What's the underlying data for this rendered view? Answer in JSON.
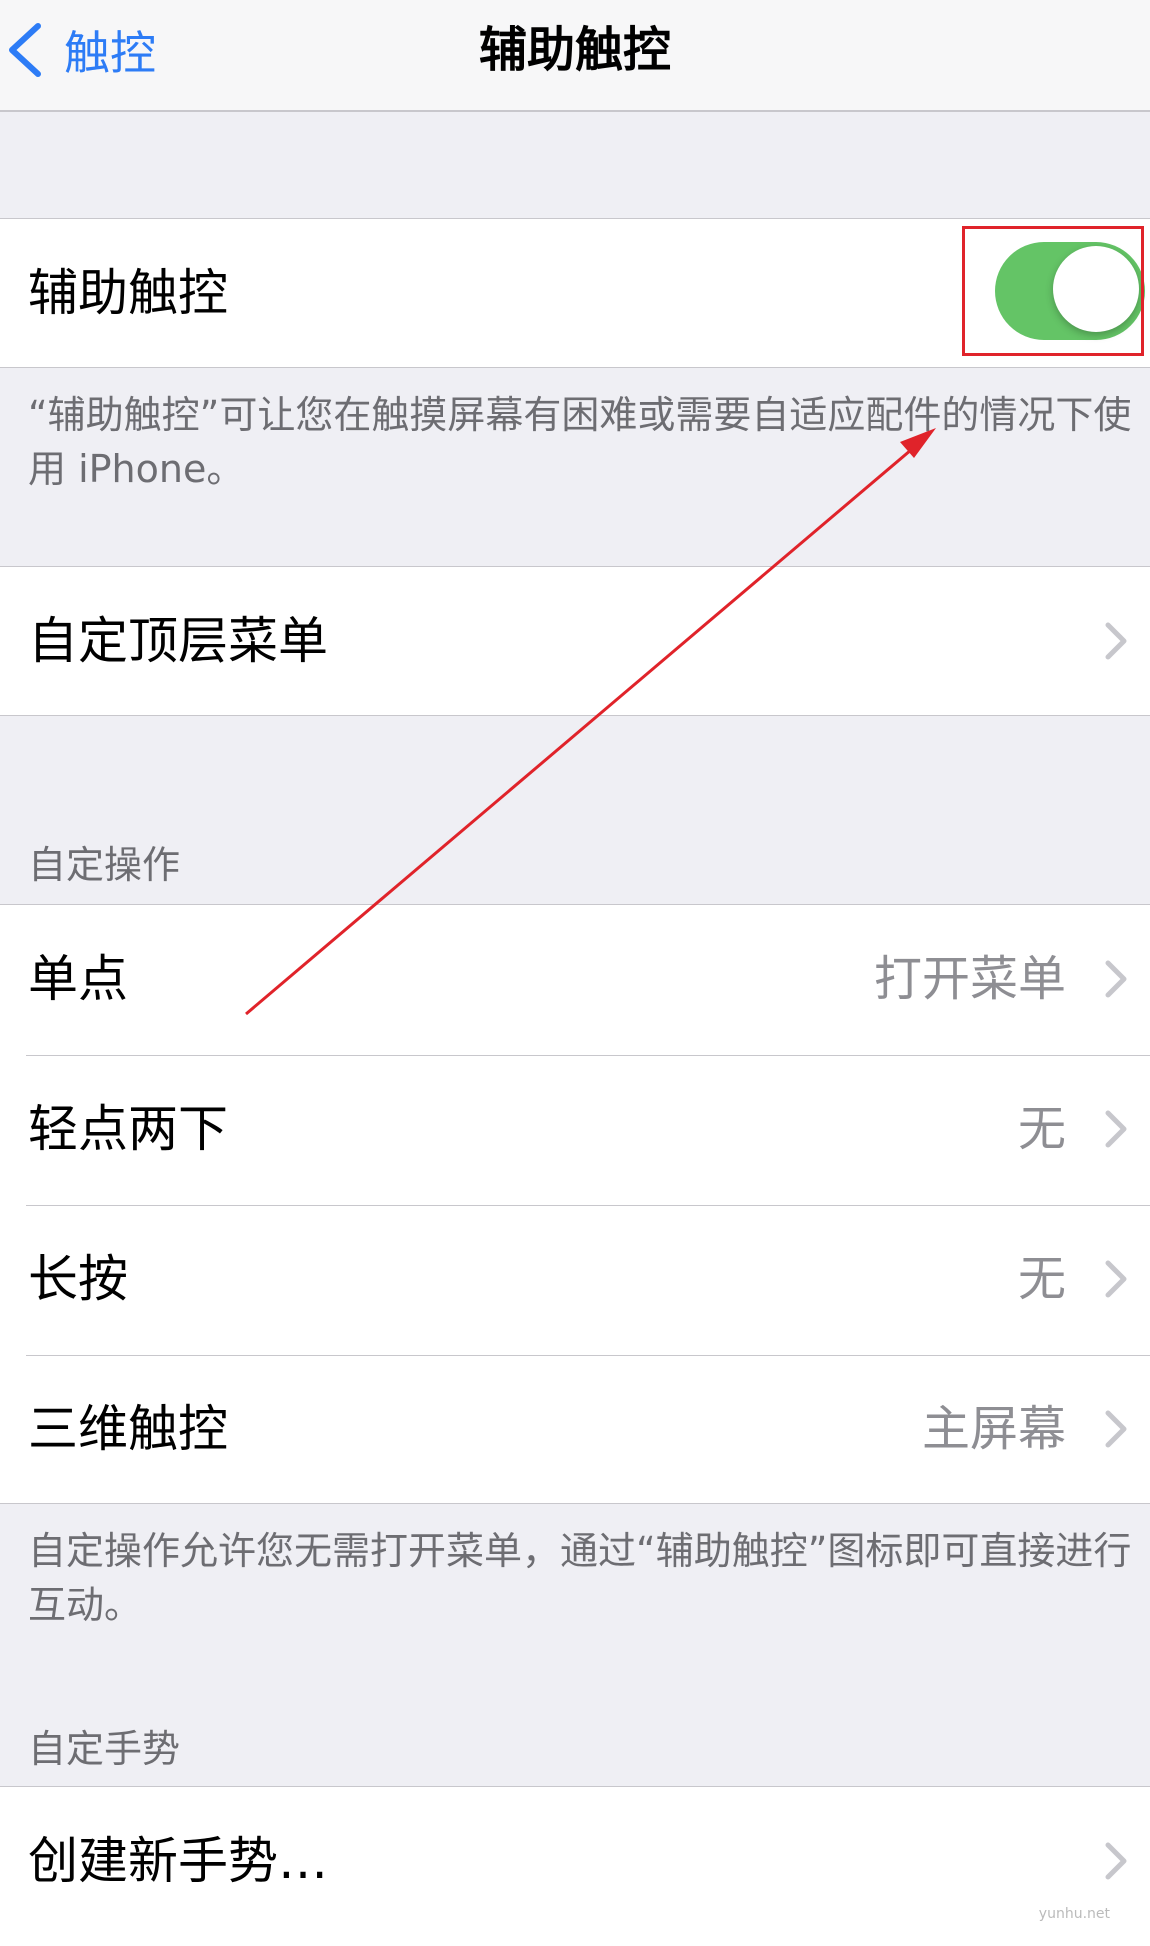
{
  "navbar": {
    "back_label": "触控",
    "title": "辅助触控"
  },
  "assistive_touch": {
    "label": "辅助触控",
    "enabled": true,
    "description": "“辅助触控”可让您在触摸屏幕有困难或需要自适应配件的情况下使用 iPhone。"
  },
  "top_menu": {
    "label": "自定顶层菜单"
  },
  "custom_actions": {
    "header": "自定操作",
    "rows": [
      {
        "label": "单点",
        "value": "打开菜单"
      },
      {
        "label": "轻点两下",
        "value": "无"
      },
      {
        "label": "长按",
        "value": "无"
      },
      {
        "label": "三维触控",
        "value": "主屏幕"
      }
    ],
    "footer": "自定操作允许您无需打开菜单，通过“辅助触控”图标即可直接进行互动。"
  },
  "custom_gestures": {
    "header": "自定手势",
    "create_label": "创建新手势…"
  },
  "annotation": {
    "color": "#e0232a"
  },
  "watermark": "yunhu.net",
  "colors": {
    "accent": "#2d7cf6",
    "toggle_on": "#64c466",
    "background": "#efeff4"
  }
}
